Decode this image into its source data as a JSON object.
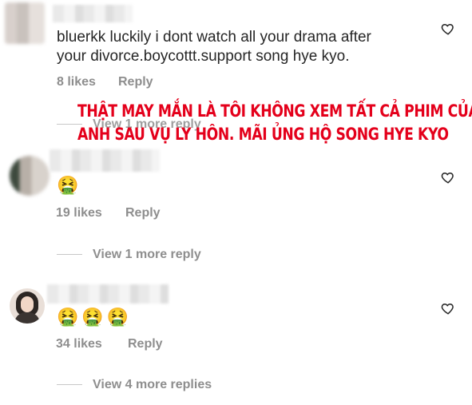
{
  "comments": [
    {
      "text": "bluerkk luckily i dont watch all your drama after your divorce.boycottt.support song hye kyo.",
      "line1": "bluerkk luckily i dont watch all your drama after",
      "line2": "your divorce.boycottt.support song hye kyo.",
      "likes": "8 likes",
      "reply": "Reply",
      "view_replies": "View 1 more reply"
    },
    {
      "emojis": "🤮",
      "likes": "19 likes",
      "reply": "Reply",
      "view_replies": "View 1 more reply"
    },
    {
      "emojis": "🤮🤮🤮",
      "likes": "34 likes",
      "reply": "Reply",
      "view_replies": "View 4 more replies"
    }
  ],
  "translation_overlay": {
    "line1": "THẬT MAY MẮN LÀ TÔI KHÔNG XEM TẤT CẢ PHIM CỦA",
    "line2": "ANH SAU VỤ LY HÔN. MÃI ỦNG HỘ SONG HYE KYO"
  },
  "icons": {
    "like": "heart-outline-icon",
    "avatar": "user-avatar"
  },
  "colors": {
    "overlay_text": "#e4001b",
    "meta_text": "#8e8e8e",
    "body_text": "#262626"
  }
}
